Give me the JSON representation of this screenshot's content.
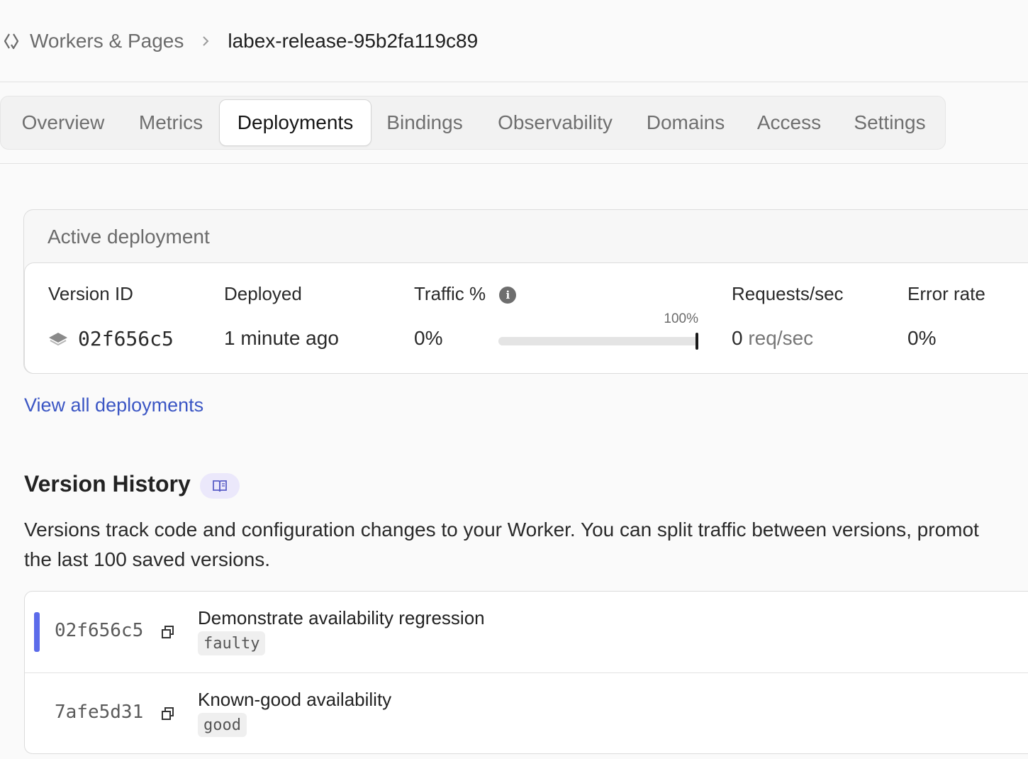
{
  "breadcrumb": {
    "parent": "Workers & Pages",
    "current": "labex-release-95b2fa119c89"
  },
  "tabs": [
    {
      "label": "Overview",
      "active": false
    },
    {
      "label": "Metrics",
      "active": false
    },
    {
      "label": "Deployments",
      "active": true
    },
    {
      "label": "Bindings",
      "active": false
    },
    {
      "label": "Observability",
      "active": false
    },
    {
      "label": "Domains",
      "active": false
    },
    {
      "label": "Access",
      "active": false
    },
    {
      "label": "Settings",
      "active": false
    }
  ],
  "active_deployment": {
    "title": "Active deployment",
    "headers": {
      "version_id": "Version ID",
      "deployed": "Deployed",
      "traffic": "Traffic %",
      "requests": "Requests/sec",
      "error_rate": "Error rate"
    },
    "version_id": "02f656c5",
    "deployed": "1 minute ago",
    "traffic_value": "0%",
    "traffic_bar_label": "100%",
    "traffic_bar_fraction": 1.0,
    "requests_value": "0",
    "requests_unit": "req/sec",
    "error_rate": "0%"
  },
  "view_all_link": "View all deployments",
  "version_history": {
    "title": "Version History",
    "description": "Versions track code and configuration changes to your Worker. You can split traffic between versions, promot\nthe last 100 saved versions.",
    "versions": [
      {
        "id": "02f656c5",
        "message": "Demonstrate availability regression",
        "tag": "faulty",
        "current": true
      },
      {
        "id": "7afe5d31",
        "message": "Known-good availability",
        "tag": "good",
        "current": false
      }
    ]
  },
  "colors": {
    "accent": "#5b6bea",
    "link": "#3b56c4",
    "docs_pill": "#ebe8fb"
  }
}
